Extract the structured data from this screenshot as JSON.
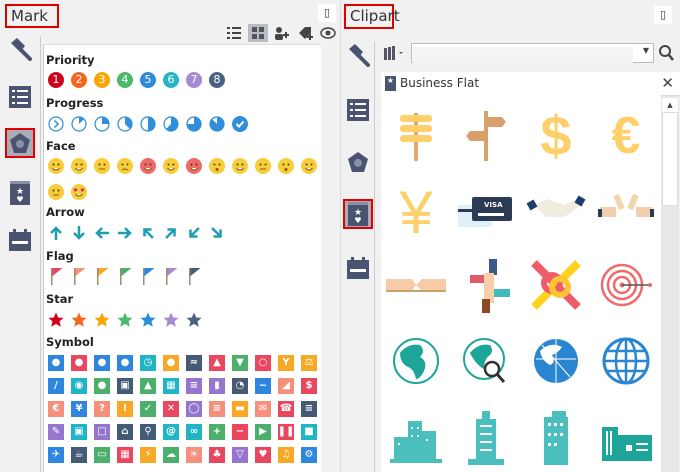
{
  "mark": {
    "title": "Mark",
    "pin_icon": "pin-icon",
    "toolbar": [
      "list-view-icon",
      "grid-view-icon",
      "add-person-icon",
      "add-tag-icon",
      "eye-icon"
    ],
    "sidebar": [
      {
        "icon": "paintbrush-icon"
      },
      {
        "icon": "outline-list-icon"
      },
      {
        "icon": "mark-pentagon-icon",
        "selected": true
      },
      {
        "icon": "clipart-book-icon"
      },
      {
        "icon": "calendar-icon"
      }
    ],
    "sections": {
      "priority": "Priority",
      "progress": "Progress",
      "face": "Face",
      "arrow": "Arrow",
      "flag": "Flag",
      "star": "Star",
      "symbol": "Symbol"
    },
    "priority": [
      {
        "n": "1",
        "c": "#d0021b"
      },
      {
        "n": "2",
        "c": "#f5661f"
      },
      {
        "n": "3",
        "c": "#f9a602"
      },
      {
        "n": "4",
        "c": "#4cb86c"
      },
      {
        "n": "5",
        "c": "#2c8ad8"
      },
      {
        "n": "6",
        "c": "#26b5c6"
      },
      {
        "n": "7",
        "c": "#a48ad0"
      },
      {
        "n": "8",
        "c": "#4a6282"
      }
    ],
    "progress": [
      0,
      0.125,
      0.25,
      0.375,
      0.5,
      0.625,
      0.75,
      0.875,
      1
    ],
    "progress_color": "#2f8fdb",
    "faces": [
      "grin",
      "smile",
      "neutral",
      "sad",
      "angry",
      "cry",
      "scared",
      "surprised",
      "smirk",
      "sleepy",
      "shocked",
      "laugh",
      "dizzy",
      "love"
    ],
    "arrows": [
      "up",
      "down",
      "left",
      "right",
      "up-left",
      "up-right",
      "down-left",
      "down-right"
    ],
    "arrow_color": "#1e9fb0",
    "flag_colors": [
      "#e8475f",
      "#f4907c",
      "#f9a825",
      "#4caf6c",
      "#2e86de",
      "#a48ad0",
      "#455a75"
    ],
    "star_colors": [
      "#d0021b",
      "#f5661f",
      "#f9a602",
      "#4cb86c",
      "#2c8ad8",
      "#a48ad0",
      "#4a6282"
    ],
    "symbols": [
      [
        [
          "person",
          "#2e86de"
        ],
        [
          "person",
          "#e8475f"
        ],
        [
          "person",
          "#2e86de"
        ],
        [
          "people",
          "#2e86de"
        ],
        [
          "alarm",
          "#1fb5c4"
        ],
        [
          "bomb",
          "#f9a825"
        ],
        [
          "handshake",
          "#455a75"
        ],
        [
          "thumbs-up",
          "#e8475f"
        ],
        [
          "thumbs-down",
          "#4caf6c"
        ],
        [
          "kettlebell",
          "#e8475f"
        ],
        [
          "trophy",
          "#f9a825"
        ],
        [
          "scales",
          "#f9a825"
        ]
      ],
      [
        [
          "telescope",
          "#2e86de"
        ],
        [
          "target",
          "#1fb5c4"
        ],
        [
          "globe",
          "#4caf6c"
        ],
        [
          "cart",
          "#455a75"
        ],
        [
          "rocket",
          "#4caf6c"
        ],
        [
          "calendar",
          "#1fb5c4"
        ],
        [
          "table",
          "#9575cd"
        ],
        [
          "bar-chart",
          "#9575cd"
        ],
        [
          "pie-chart",
          "#455a75"
        ],
        [
          "line-chart",
          "#2e86de"
        ],
        [
          "area-chart",
          "#f4907c"
        ],
        [
          "dollar",
          "#e8475f"
        ]
      ],
      [
        [
          "euro",
          "#f4907c"
        ],
        [
          "yen",
          "#2e86de"
        ],
        [
          "question",
          "#f4907c"
        ],
        [
          "exclamation",
          "#f9a825"
        ],
        [
          "check",
          "#4caf6c"
        ],
        [
          "cross",
          "#e8475f"
        ],
        [
          "lightbulb",
          "#9575cd"
        ],
        [
          "layers",
          "#f4907c"
        ],
        [
          "folder",
          "#f9a825"
        ],
        [
          "mail",
          "#f4907c"
        ],
        [
          "phone",
          "#e8475f"
        ],
        [
          "document",
          "#455a75"
        ]
      ],
      [
        [
          "pencil",
          "#9575cd"
        ],
        [
          "lock",
          "#1fb5c4"
        ],
        [
          "unlock",
          "#9575cd"
        ],
        [
          "home",
          "#455a75"
        ],
        [
          "search",
          "#455a75"
        ],
        [
          "at",
          "#1fb5c4"
        ],
        [
          "link",
          "#1fb5c4"
        ],
        [
          "plus",
          "#4caf6c"
        ],
        [
          "minus",
          "#e8475f"
        ],
        [
          "play",
          "#4caf6c"
        ],
        [
          "pause",
          "#e8475f"
        ],
        [
          "stop",
          "#1fb5c4"
        ]
      ],
      [
        [
          "plane",
          "#2e86de"
        ],
        [
          "coffee",
          "#455a75"
        ],
        [
          "battery",
          "#4caf6c"
        ],
        [
          "map",
          "#e8475f"
        ],
        [
          "lightning",
          "#f9a825"
        ],
        [
          "rain",
          "#4caf6c"
        ],
        [
          "sun",
          "#f4907c"
        ],
        [
          "tree",
          "#e8475f"
        ],
        [
          "tornado",
          "#9575cd"
        ],
        [
          "heart",
          "#e8475f"
        ],
        [
          "music",
          "#f9a825"
        ],
        [
          "gear",
          "#2e86de"
        ]
      ]
    ]
  },
  "clipart": {
    "title": "Clipart",
    "pin_icon": "pin-icon",
    "sidebar": [
      {
        "icon": "paintbrush-icon"
      },
      {
        "icon": "outline-list-icon"
      },
      {
        "icon": "mark-pentagon-icon"
      },
      {
        "icon": "clipart-book-icon",
        "selected": true
      },
      {
        "icon": "calendar-icon"
      }
    ],
    "search": {
      "value": "",
      "placeholder": ""
    },
    "library_tab": "Business Flat",
    "items": [
      "wooden-signpost",
      "direction-signpost",
      "dollar",
      "euro",
      "yen",
      "visa-card",
      "handshake",
      "toast",
      "tug-hands",
      "stacked-hands",
      "linked-rings",
      "target-arrow",
      "globe-africa",
      "globe-search",
      "globe-americas",
      "globe-grid",
      "city-buildings",
      "skyscraper",
      "office-tower",
      "factory"
    ]
  }
}
